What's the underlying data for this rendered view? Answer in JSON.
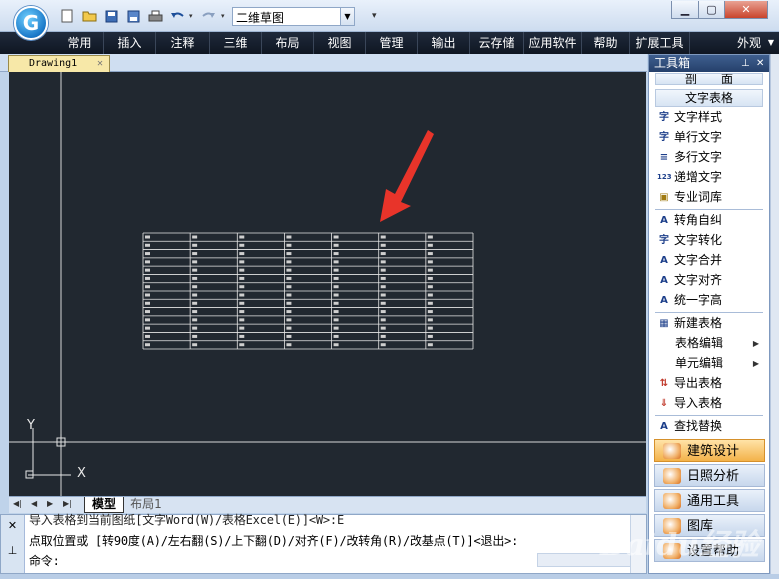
{
  "quick_toolbar": {
    "workspace": "二维草图"
  },
  "menu": [
    "常用",
    "插入",
    "注释",
    "三维",
    "布局",
    "视图",
    "管理",
    "输出",
    "云存储",
    "应用软件",
    "帮助",
    "扩展工具"
  ],
  "appearance": "外观",
  "document": {
    "tab": "Drawing1"
  },
  "layout_tabs": {
    "model": "模型",
    "layout1": "布局1"
  },
  "ucs": {
    "x_label": "X",
    "y_label": "Y"
  },
  "table_grid": {
    "rows": 14,
    "cols": 7
  },
  "command": {
    "line1": "导入表格到当前图纸[文字Word(W)/表格Excel(E)]<W>:E",
    "line2": "点取位置或 [转90度(A)/左右翻(S)/上下翻(D)/对齐(F)/改转角(R)/改基点(T)]<退出>:",
    "prompt": "命令:"
  },
  "toolbox": {
    "title": "工具箱",
    "section_cut": "剖　　面",
    "section_text": "文字表格",
    "items_text": [
      {
        "label": "文字样式",
        "icon": "text-style-icon"
      },
      {
        "label": "单行文字",
        "icon": "single-line-text-icon"
      },
      {
        "label": "多行文字",
        "icon": "multi-line-text-icon"
      },
      {
        "label": "递增文字",
        "icon": "increment-text-icon"
      },
      {
        "label": "专业词库",
        "icon": "dictionary-icon"
      }
    ],
    "items_convert": [
      {
        "label": "转角自纠",
        "icon": "rotate-fix-icon"
      },
      {
        "label": "文字转化",
        "icon": "text-convert-icon"
      },
      {
        "label": "文字合并",
        "icon": "text-merge-icon"
      },
      {
        "label": "文字对齐",
        "icon": "text-align-icon"
      },
      {
        "label": "统一字高",
        "icon": "text-height-icon"
      }
    ],
    "items_table": [
      {
        "label": "新建表格",
        "icon": "new-table-icon"
      },
      {
        "label": "表格编辑",
        "icon": "",
        "submenu": true
      },
      {
        "label": "单元编辑",
        "icon": "",
        "submenu": true
      },
      {
        "label": "导出表格",
        "icon": "export-table-icon"
      },
      {
        "label": "导入表格",
        "icon": "import-table-icon"
      }
    ],
    "find_replace": "查找替换",
    "big_buttons": [
      "建筑设计",
      "日照分析",
      "通用工具",
      "图库",
      "设置帮助"
    ]
  },
  "watermark": "Baidu经验"
}
